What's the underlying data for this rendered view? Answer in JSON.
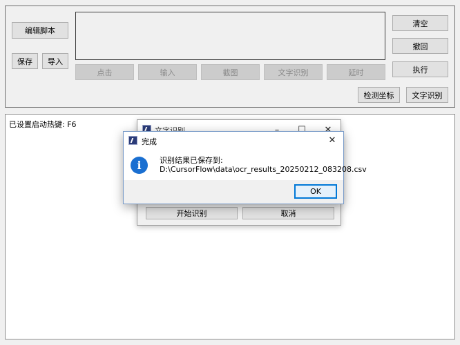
{
  "editor": {
    "edit_script": "编辑脚本",
    "save": "保存",
    "import": "导入",
    "actions": [
      "点击",
      "输入",
      "截图",
      "文字识别",
      "延时"
    ],
    "clear": "清空",
    "undo": "撤回",
    "run": "执行",
    "detect_coords": "检测坐标",
    "ocr": "文字识别"
  },
  "log": {
    "text": "已设置启动热键: F6"
  },
  "ocr_dialog": {
    "title": "文字识别",
    "start": "开始识别",
    "cancel": "取消"
  },
  "message_box": {
    "title": "完成",
    "line1": "识别结果已保存到:",
    "line2": "D:\\CursorFlow\\data\\ocr_results_20250212_083208.csv",
    "ok": "OK"
  },
  "colors": {
    "accent": "#0078d7",
    "info_icon": "#1a6fd1"
  },
  "icons": {
    "app": "app-icon",
    "info": "info-icon"
  }
}
